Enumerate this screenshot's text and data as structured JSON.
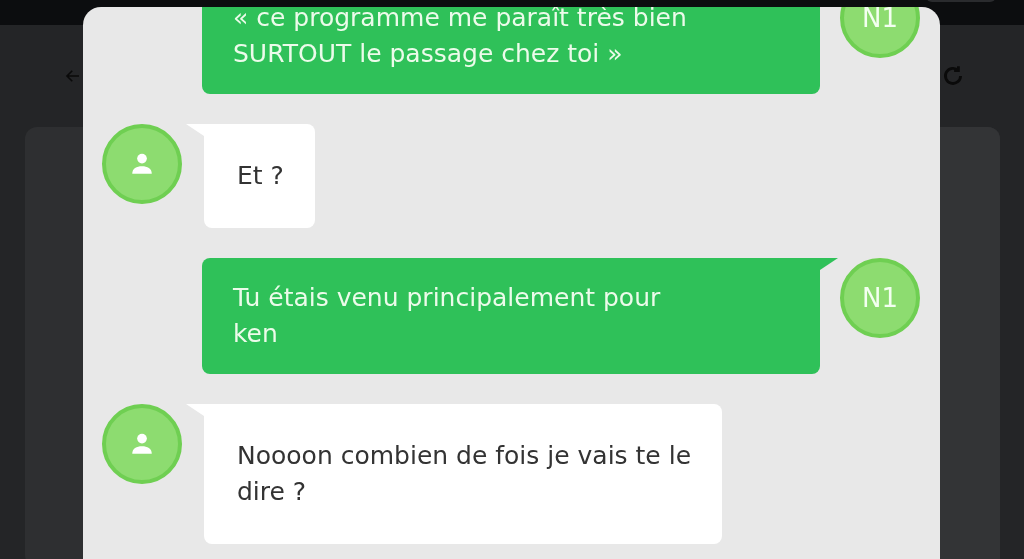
{
  "messages": [
    {
      "kind": "sent",
      "text": "« ce programme me paraît très bien\nSURTOUT le passage chez toi »",
      "avatar": "N1"
    },
    {
      "kind": "received",
      "text": "Et ?"
    },
    {
      "kind": "sent",
      "text": "Tu étais venu principalement pour\nken",
      "avatar": "N1"
    },
    {
      "kind": "received",
      "text": "Noooon combien de fois je vais te le\ndire ?"
    }
  ]
}
